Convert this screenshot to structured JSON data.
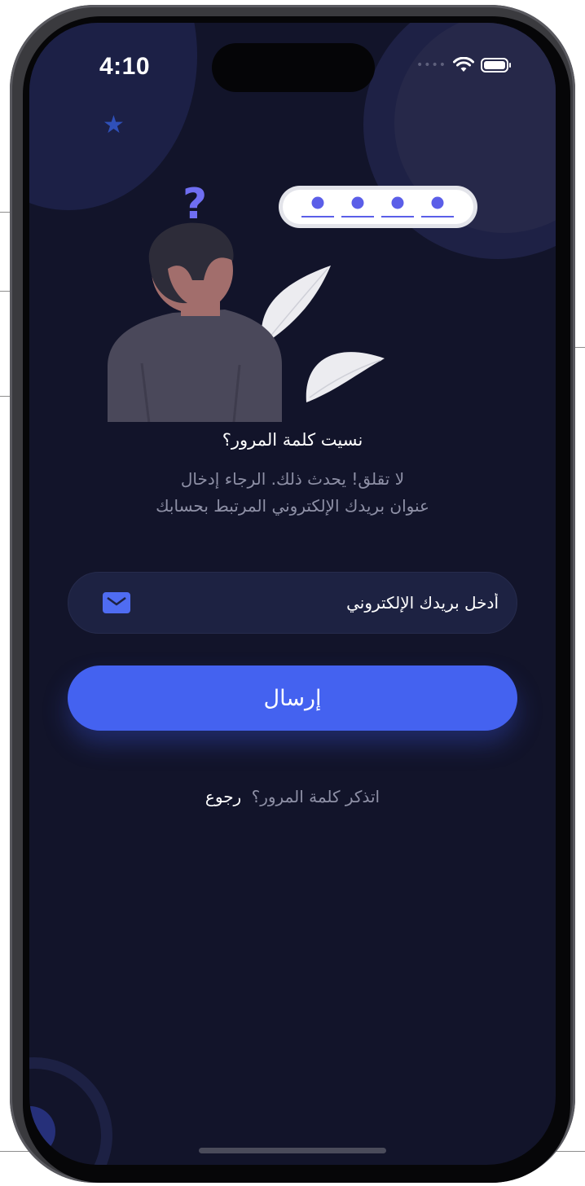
{
  "status_bar": {
    "time": "4:10",
    "signal_icon": "cellular-dots-icon",
    "wifi_icon": "wifi-icon",
    "battery_icon": "battery-icon"
  },
  "decoration": {
    "star_glyph": "★",
    "question_mark": "?"
  },
  "header": {
    "title": "نسيت كلمة المرور؟",
    "subtitle_line1": "لا تقلق! يحدث ذلك. الرجاء إدخال",
    "subtitle_line2": "عنوان بريدك الإلكتروني المرتبط بحسابك"
  },
  "form": {
    "email_placeholder": "أدخل بريدك الإلكتروني",
    "email_value": "",
    "email_icon": "mail-icon",
    "submit_label": "إرسال"
  },
  "footer": {
    "prompt": "اتذكر كلمة المرور؟",
    "back_link": "رجوع"
  },
  "colors": {
    "background": "#12142a",
    "accent": "#4462f0",
    "field_background": "#1d2242",
    "muted_text": "#8e90a6",
    "text": "#ffffff"
  }
}
